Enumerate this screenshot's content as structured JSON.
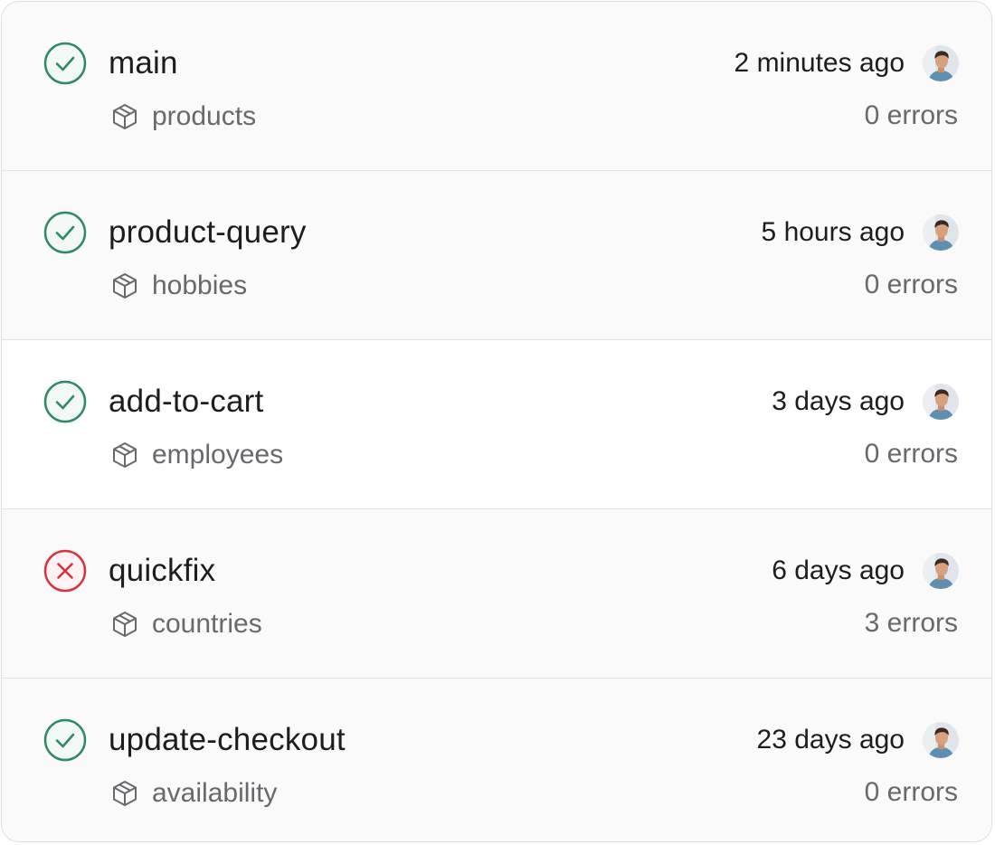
{
  "colors": {
    "success": "#2f8a64",
    "failure": "#d6343f",
    "text_primary": "#1d1d1f",
    "text_secondary": "#68686d"
  },
  "branches": [
    {
      "name": "main",
      "status": "success",
      "status_icon": "check-circle-icon",
      "package": "products",
      "package_icon": "package-icon",
      "time": "2 minutes ago",
      "errors": "0 errors"
    },
    {
      "name": "product-query",
      "status": "success",
      "status_icon": "check-circle-icon",
      "package": "hobbies",
      "package_icon": "package-icon",
      "time": "5 hours ago",
      "errors": "0 errors"
    },
    {
      "name": "add-to-cart",
      "status": "success",
      "status_icon": "check-circle-icon",
      "package": "employees",
      "package_icon": "package-icon",
      "time": "3 days ago",
      "errors": "0 errors"
    },
    {
      "name": "quickfix",
      "status": "failure",
      "status_icon": "x-circle-icon",
      "package": "countries",
      "package_icon": "package-icon",
      "time": "6 days ago",
      "errors": "3 errors"
    },
    {
      "name": "update-checkout",
      "status": "success",
      "status_icon": "check-circle-icon",
      "package": "availability",
      "package_icon": "package-icon",
      "time": "23 days ago",
      "errors": "0 errors"
    }
  ]
}
